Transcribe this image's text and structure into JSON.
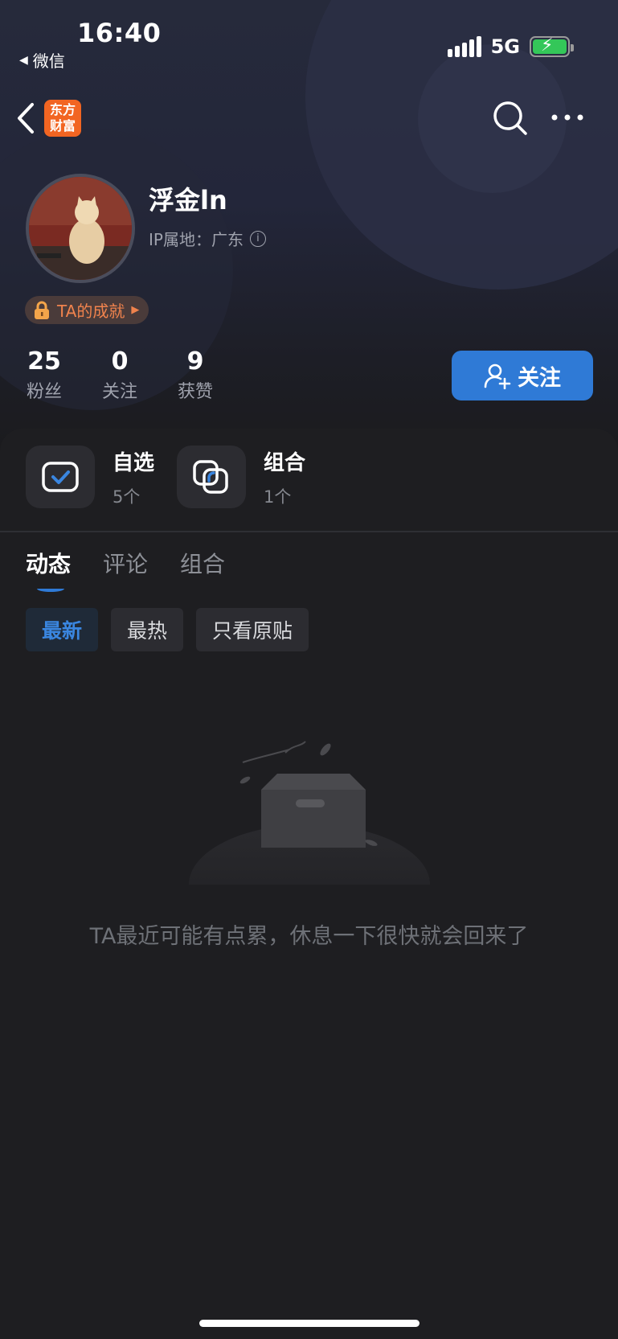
{
  "status_bar": {
    "time": "16:40",
    "back_app": "微信",
    "network": "5G"
  },
  "nav": {
    "logo_text_line1": "东方",
    "logo_text_line2": "财富",
    "brand_color": "#f26522"
  },
  "profile": {
    "username": "浮金ln",
    "ip_location": "IP属地：广东",
    "achievement_label": "TA的成就",
    "stats": [
      {
        "value": "25",
        "label": "粉丝"
      },
      {
        "value": "0",
        "label": "关注"
      },
      {
        "value": "9",
        "label": "获赞"
      }
    ],
    "follow_label": "关注",
    "accent_color": "#2f7ad6"
  },
  "shortcuts": [
    {
      "title": "自选",
      "count": "5个",
      "icon": "watchlist-check-icon"
    },
    {
      "title": "组合",
      "count": "1个",
      "icon": "portfolio-overlap-icon"
    }
  ],
  "tabs": [
    {
      "label": "动态",
      "active": true
    },
    {
      "label": "评论",
      "active": false
    },
    {
      "label": "组合",
      "active": false
    }
  ],
  "filters": [
    {
      "label": "最新",
      "active": true
    },
    {
      "label": "最热",
      "active": false
    },
    {
      "label": "只看原贴",
      "active": false
    }
  ],
  "empty_state": {
    "message": "TA最近可能有点累，休息一下很快就会回来了",
    "icon": "empty-box-icon"
  }
}
